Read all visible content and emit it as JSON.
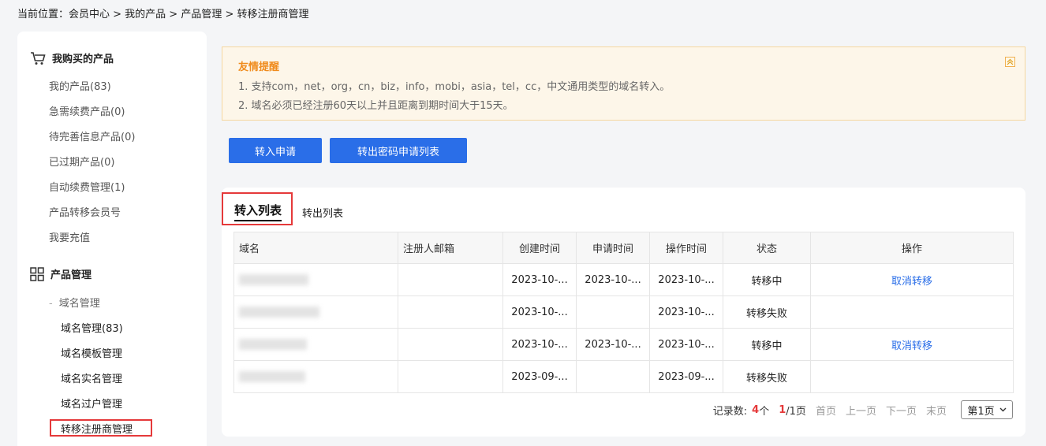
{
  "breadcrumb": {
    "text": "当前位置：会员中心 > 我的产品 > 产品管理 > 转移注册商管理"
  },
  "sidebar": {
    "group1": {
      "title": "我购买的产品",
      "icon": "cart-icon",
      "items": [
        "我的产品(83)",
        "急需续费产品(0)",
        "待完善信息产品(0)",
        "已过期产品(0)",
        "自动续费管理(1)",
        "产品转移会员号",
        "我要充值"
      ]
    },
    "group2": {
      "title": "产品管理",
      "icon": "grid-icon",
      "subhead": "域名管理",
      "items": [
        "域名管理(83)",
        "域名模板管理",
        "域名实名管理",
        "域名过户管理",
        "转移注册商管理"
      ]
    }
  },
  "notice": {
    "title": "友情提醒",
    "line1": "1. 支持com，net，org，cn，biz，info，mobi，asia，tel，cc，中文通用类型的域名转入。",
    "line2": "2. 域名必须已经注册60天以上并且距离到期时间大于15天。"
  },
  "buttons": {
    "transfer_in": "转入申请",
    "transfer_out_list": "转出密码申请列表"
  },
  "tabs": {
    "active": "转入列表",
    "inactive": "转出列表"
  },
  "table": {
    "headers": [
      "域名",
      "注册人邮箱",
      "创建时间",
      "申请时间",
      "操作时间",
      "状态",
      "操作"
    ],
    "rows": [
      {
        "created": "2023-10-...",
        "applied": "2023-10-...",
        "operated": "2023-10-...",
        "status": "转移中",
        "action": "取消转移"
      },
      {
        "created": "2023-10-...",
        "applied": "",
        "operated": "2023-10-...",
        "status": "转移失败",
        "action": ""
      },
      {
        "created": "2023-10-...",
        "applied": "2023-10-...",
        "operated": "2023-10-...",
        "status": "转移中",
        "action": "取消转移"
      },
      {
        "created": "2023-09-...",
        "applied": "",
        "operated": "2023-09-...",
        "status": "转移失败",
        "action": ""
      }
    ]
  },
  "pager": {
    "label": "记录数:",
    "count": "4",
    "unit": "个",
    "current": "1",
    "total": "/1页",
    "first": "首页",
    "prev": "上一页",
    "next": "下一页",
    "last": "末页",
    "select": "第1页"
  },
  "colors": {
    "accent": "#2a6ee8",
    "highlight_red": "#e5393a",
    "notice_title": "#f08c1e"
  }
}
